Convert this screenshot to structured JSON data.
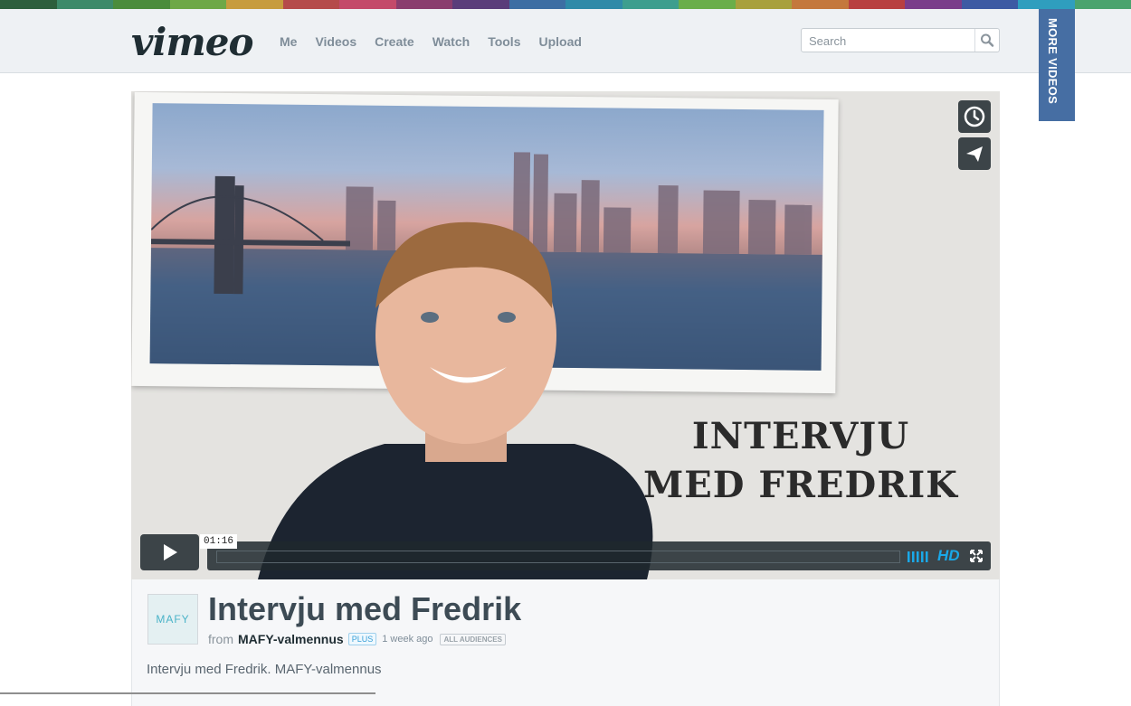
{
  "colors": {
    "stripe": [
      "#2d5f3d",
      "#3d8a6a",
      "#4b8c3c",
      "#6ea847",
      "#c79c3e",
      "#b54b4b",
      "#c44a6a",
      "#8a3d6e",
      "#5a3d7a",
      "#3d6ea3",
      "#2f8aa8",
      "#3d9e8e",
      "#6aae4a",
      "#a8a03d",
      "#c4783d",
      "#b84040",
      "#7a3d8a",
      "#3d5aa3",
      "#2f9ebe",
      "#4aa36e"
    ],
    "accent": "#1aa8e8",
    "more_tab": "#466ea3"
  },
  "header": {
    "logo": "vimeo",
    "nav": [
      "Me",
      "Videos",
      "Create",
      "Watch",
      "Tools",
      "Upload"
    ],
    "search_placeholder": "Search",
    "search_icon": "search-icon"
  },
  "more_videos_label": "MORE VIDEOS",
  "player": {
    "title_overlay_line1": "INTERVJU",
    "title_overlay_line2": "MED FREDRIK",
    "time": "01:16",
    "hd_label": "HD",
    "icons": [
      "clock-icon",
      "paper-plane-icon",
      "play-icon",
      "volume-bars-icon",
      "fullscreen-icon"
    ]
  },
  "video": {
    "avatar_text": "MAFY",
    "title": "Intervju med Fredrik",
    "from_label": "from",
    "owner": "MAFY-valmennus",
    "badge": "PLUS",
    "time_ago": "1 week ago",
    "audience": "ALL AUDIENCES",
    "description": "Intervju med Fredrik. MAFY-valmennus"
  }
}
